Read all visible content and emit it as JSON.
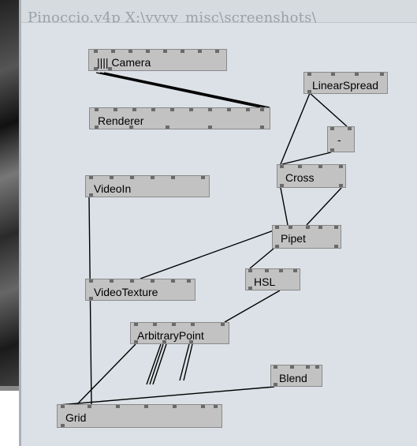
{
  "window": {
    "title": "Pinoccio.v4p    X:\\vvvv_misc\\screenshots\\"
  },
  "nodes": {
    "camera": "|||| Camera",
    "renderer": "Renderer",
    "linearspread": "LinearSpread",
    "minus": "-",
    "cross": "Cross",
    "videoin": "VideoIn",
    "pipet": "Pipet",
    "hsl": "HSL",
    "videotexture": "VideoTexture",
    "arbitrarypoint": "ArbitraryPoint",
    "blend": "Blend",
    "grid": "Grid"
  },
  "colors": {
    "window_background": "#dbe1e6",
    "node_fill": "#c2c2c2",
    "pin": "#6a6a6a",
    "link": "#000000"
  }
}
